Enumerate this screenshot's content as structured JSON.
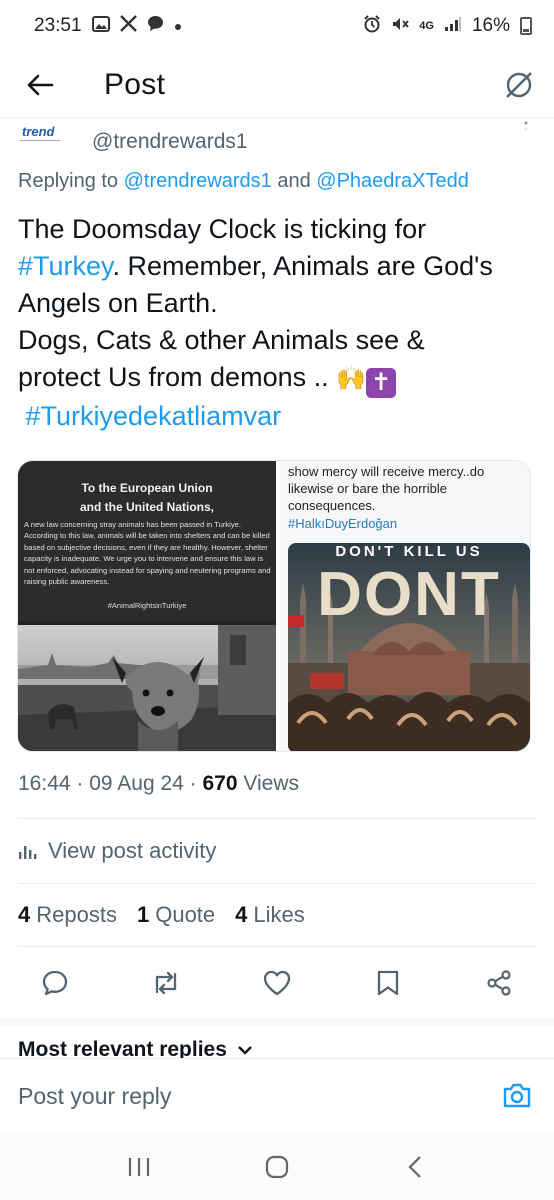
{
  "status_bar": {
    "time": "23:51",
    "network": "4G",
    "battery": "16%"
  },
  "header": {
    "title": "Post"
  },
  "quoted": {
    "logo_text": "trend",
    "handle": "@trendrewards1"
  },
  "replying": {
    "prefix": "Replying to ",
    "mention1": "@trendrewards1",
    "joiner": " and ",
    "mention2": "@PhaedraXTedd"
  },
  "tweet": {
    "line1": "The Doomsday Clock is ticking for",
    "hashtag1": "#Turkey",
    "line2_rest": ". Remember, Animals are God's",
    "line3": "Angels on Earth.",
    "line4": "Dogs, Cats & other Animals see &",
    "line5": "protect Us from demons .. ",
    "emoji_hands": "🙌",
    "emoji_cross": "✝",
    "hashtag2": "#Turkiyedekatliamvar"
  },
  "media": {
    "letter_title_1": "To the European Union",
    "letter_title_2": "and the United Nations,",
    "letter_body": "A new law concerning stray animals has been passed in Turkiye. According to this law, animals will be taken into shelters and can be killed based on subjective decisions, even if they are healthy. However, shelter capacity is inadequate. We urge you to intervene and ensure this law is not enforced, advocating instead for spaying and neutering programs and raising public awareness.",
    "letter_tag": "#AnimalRightsinTurkiye",
    "mercy_text": "show mercy will receive mercy..do likewise or bare the horrible consequences.",
    "mercy_tag": "#HalkıDuyErdoğan",
    "poster_top": "DON'T KILL US",
    "poster_big": "DONT"
  },
  "meta": {
    "time": "16:44",
    "date": "09 Aug 24",
    "views_count": "670",
    "views_label": "Views"
  },
  "activity": {
    "label": "View post activity"
  },
  "stats": {
    "reposts_count": "4",
    "reposts_label": "Reposts",
    "quotes_count": "1",
    "quotes_label": "Quote",
    "likes_count": "4",
    "likes_label": "Likes"
  },
  "replies": {
    "sort_label": "Most relevant replies"
  },
  "reply_bar": {
    "placeholder": "Post your reply"
  },
  "colors": {
    "accent": "#1d9bf0",
    "secondary_text": "#536471",
    "primary_text": "#0f1419"
  }
}
